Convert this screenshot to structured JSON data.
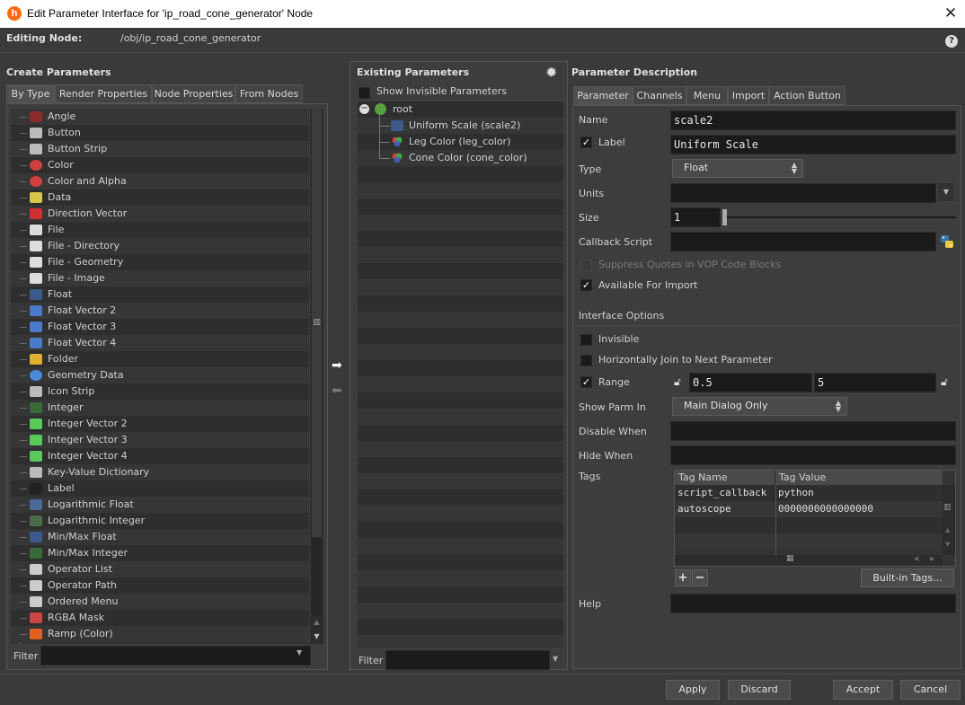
{
  "window": {
    "title": "Edit Parameter Interface for 'ip_road_cone_generator' Node"
  },
  "editing_node": {
    "label": "Editing Node:",
    "path": "/obj/ip_road_cone_generator"
  },
  "create_panel": {
    "title": "Create Parameters",
    "tabs": [
      "By Type",
      "Render Properties",
      "Node Properties",
      "From Nodes"
    ],
    "items": [
      {
        "label": "Angle",
        "icon": "angle-icon"
      },
      {
        "label": "Button",
        "icon": "button-icon"
      },
      {
        "label": "Button Strip",
        "icon": "button-strip-icon"
      },
      {
        "label": "Color",
        "icon": "color-icon"
      },
      {
        "label": "Color and Alpha",
        "icon": "color-alpha-icon"
      },
      {
        "label": "Data",
        "icon": "data-icon"
      },
      {
        "label": "Direction Vector",
        "icon": "direction-vector-icon"
      },
      {
        "label": "File",
        "icon": "file-icon"
      },
      {
        "label": "File - Directory",
        "icon": "file-directory-icon"
      },
      {
        "label": "File - Geometry",
        "icon": "file-geometry-icon"
      },
      {
        "label": "File - Image",
        "icon": "file-image-icon"
      },
      {
        "label": "Float",
        "icon": "float-icon"
      },
      {
        "label": "Float Vector 2",
        "icon": "float-vector2-icon"
      },
      {
        "label": "Float Vector 3",
        "icon": "float-vector3-icon"
      },
      {
        "label": "Float Vector 4",
        "icon": "float-vector4-icon"
      },
      {
        "label": "Folder",
        "icon": "folder-icon"
      },
      {
        "label": "Geometry Data",
        "icon": "geometry-data-icon"
      },
      {
        "label": "Icon Strip",
        "icon": "icon-strip-icon"
      },
      {
        "label": "Integer",
        "icon": "integer-icon"
      },
      {
        "label": "Integer Vector 2",
        "icon": "integer-vector2-icon"
      },
      {
        "label": "Integer Vector 3",
        "icon": "integer-vector3-icon"
      },
      {
        "label": "Integer Vector 4",
        "icon": "integer-vector4-icon"
      },
      {
        "label": "Key-Value Dictionary",
        "icon": "key-value-icon"
      },
      {
        "label": "Label",
        "icon": "label-icon"
      },
      {
        "label": "Logarithmic Float",
        "icon": "log-float-icon"
      },
      {
        "label": "Logarithmic Integer",
        "icon": "log-integer-icon"
      },
      {
        "label": "Min/Max Float",
        "icon": "minmax-float-icon"
      },
      {
        "label": "Min/Max Integer",
        "icon": "minmax-integer-icon"
      },
      {
        "label": "Operator List",
        "icon": "operator-list-icon"
      },
      {
        "label": "Operator Path",
        "icon": "operator-path-icon"
      },
      {
        "label": "Ordered Menu",
        "icon": "ordered-menu-icon"
      },
      {
        "label": "RGBA Mask",
        "icon": "rgba-mask-icon"
      },
      {
        "label": "Ramp (Color)",
        "icon": "ramp-color-icon"
      }
    ],
    "filter_label": "Filter"
  },
  "existing_panel": {
    "title": "Existing Parameters",
    "show_invisible": "Show Invisible Parameters",
    "tree": {
      "root": "root",
      "children": [
        "Uniform Scale (scale2)",
        "Leg Color (leg_color)",
        "Cone Color (cone_color)"
      ]
    },
    "filter_label": "Filter"
  },
  "desc_panel": {
    "title": "Parameter Description",
    "tabs": [
      "Parameter",
      "Channels",
      "Menu",
      "Import",
      "Action Button"
    ],
    "name_label": "Name",
    "name_value": "scale2",
    "label_label": "Label",
    "label_value": "Uniform Scale",
    "type_label": "Type",
    "type_value": "Float",
    "units_label": "Units",
    "units_value": "",
    "size_label": "Size",
    "size_value": "1",
    "callback_label": "Callback Script",
    "callback_value": "",
    "suppress_label": "Suppress Quotes in VOP Code Blocks",
    "available_label": "Available For Import",
    "interface_options": "Interface Options",
    "invisible_label": "Invisible",
    "join_label": "Horizontally Join to Next Parameter",
    "range_label": "Range",
    "range_min": "0.5",
    "range_max": "5",
    "show_parm_label": "Show Parm In",
    "show_parm_value": "Main Dialog Only",
    "disable_when_label": "Disable When",
    "hide_when_label": "Hide When",
    "tags_label": "Tags",
    "tags_columns": [
      "Tag Name",
      "Tag Value"
    ],
    "tags_rows": [
      [
        "script_callback",
        "python"
      ],
      [
        "autoscope",
        "0000000000000000"
      ]
    ],
    "builtin_tags": "Built-in Tags...",
    "help_label": "Help"
  },
  "footer": {
    "apply": "Apply",
    "discard": "Discard",
    "accept": "Accept",
    "cancel": "Cancel"
  }
}
